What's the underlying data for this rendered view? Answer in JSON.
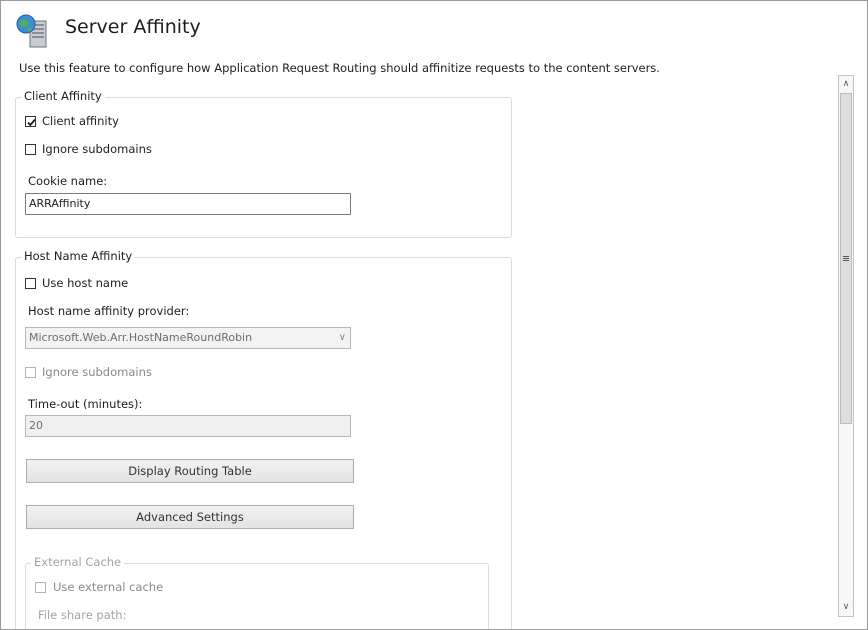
{
  "header": {
    "title": "Server Affinity",
    "icon": "server-globe-icon",
    "description": "Use this feature to configure how Application Request Routing should affinitize requests to the content servers."
  },
  "client_affinity": {
    "legend": "Client Affinity",
    "client_affinity_label": "Client affinity",
    "client_affinity_checked": true,
    "ignore_subdomains_label": "Ignore subdomains",
    "ignore_subdomains_checked": false,
    "cookie_name_label": "Cookie name:",
    "cookie_name_value": "ARRAffinity"
  },
  "host_name_affinity": {
    "legend": "Host Name Affinity",
    "use_host_name_label": "Use host name",
    "use_host_name_checked": false,
    "provider_label": "Host name affinity provider:",
    "provider_value": "Microsoft.Web.Arr.HostNameRoundRobin",
    "ignore_subdomains_label": "Ignore subdomains",
    "timeout_label": "Time-out (minutes):",
    "timeout_value": "20",
    "display_routing_table_button": "Display Routing Table",
    "advanced_settings_button": "Advanced Settings"
  },
  "external_cache": {
    "legend": "External Cache",
    "use_external_cache_label": "Use external cache",
    "file_share_path_label": "File share path:"
  },
  "colors": {
    "border": "#dcdcdc",
    "disabled_text": "#8a8a8a",
    "disabled_field_bg": "#f0f0f0"
  }
}
